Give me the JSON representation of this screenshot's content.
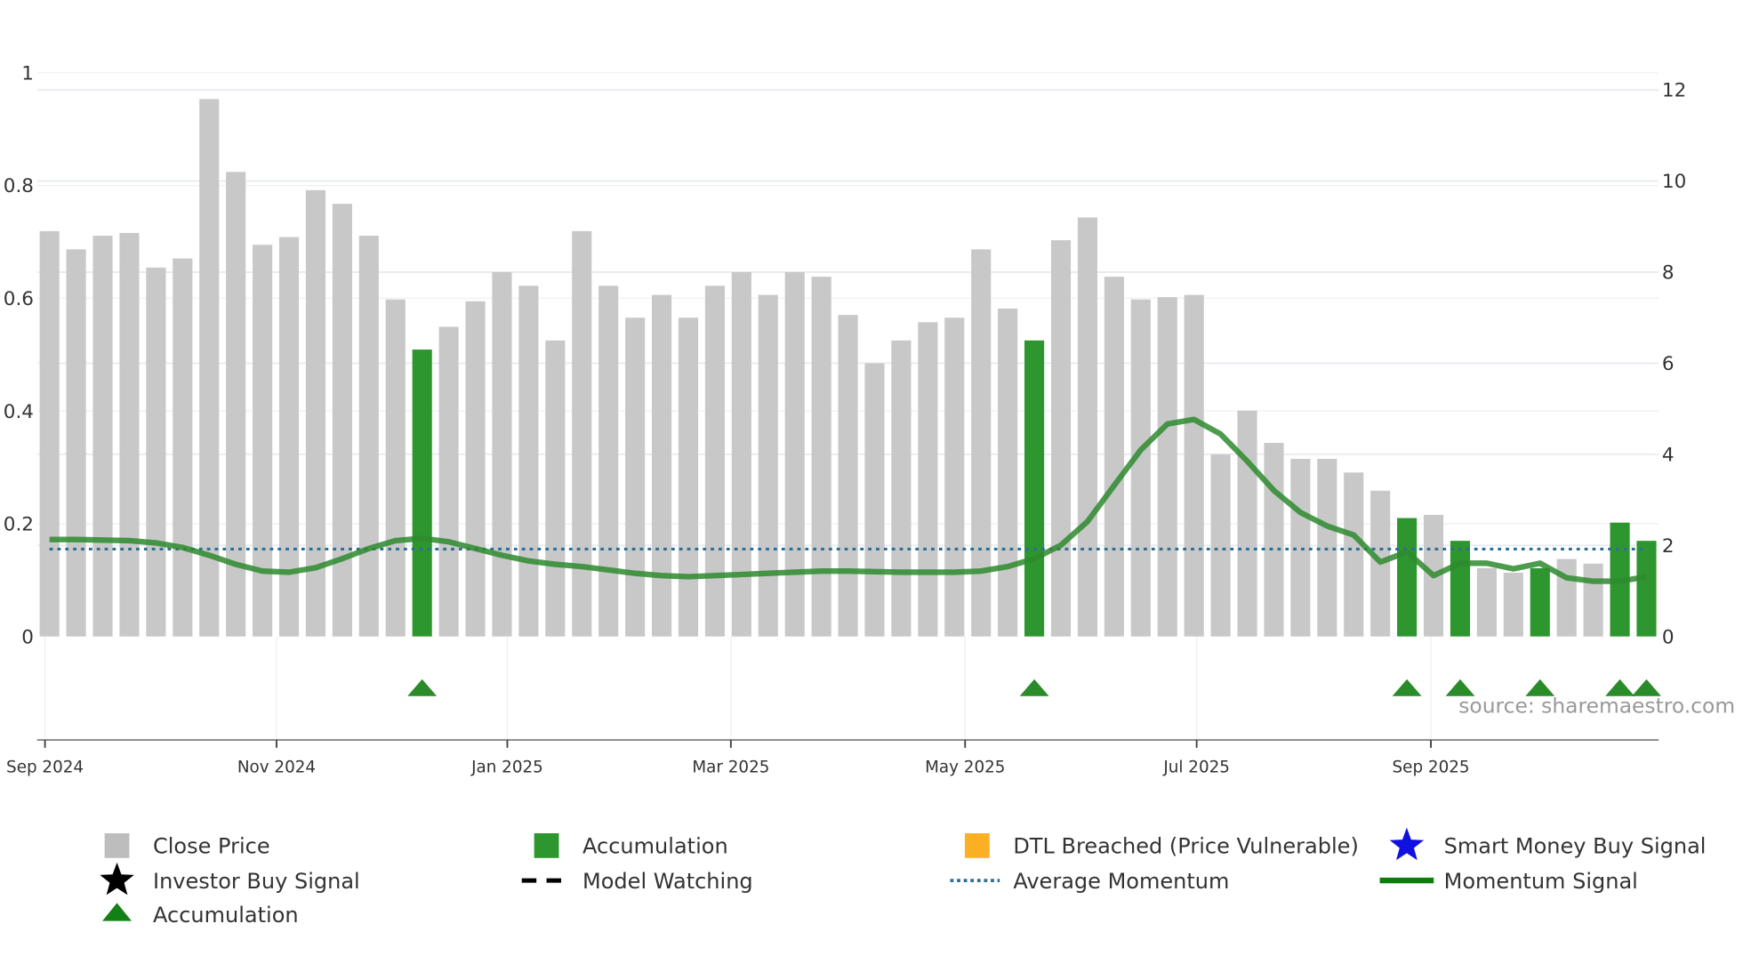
{
  "chart_data": {
    "type": "bar",
    "title": "",
    "colors": {
      "close": "#c8c8c8",
      "accumulation": "#2e962e",
      "momentum": "#1f8a1f",
      "average": "#2f6f96",
      "triangle": "#128012",
      "dtl": "#fbb024",
      "smart_money": "#1010e0",
      "investor": "#000000"
    },
    "left_axis": {
      "range": [
        0,
        1
      ],
      "ticks": [
        0,
        0.2,
        0.4,
        0.6,
        0.8,
        1
      ],
      "tick_labels": [
        "0",
        "0.2",
        "0.4",
        "0.6",
        "0.8",
        "1"
      ]
    },
    "right_axis": {
      "range": [
        0,
        12
      ],
      "ticks": [
        0,
        2,
        4,
        6,
        8,
        10,
        12
      ],
      "tick_labels": [
        "0",
        "2",
        "4",
        "6",
        "8",
        "10",
        "12"
      ]
    },
    "x_ticks": [
      {
        "label": "Sep 2024",
        "at": 0.83
      },
      {
        "label": "Nov 2024",
        "at": 9.53
      },
      {
        "label": "Jan 2025",
        "at": 18.2
      },
      {
        "label": "Mar 2025",
        "at": 26.6
      },
      {
        "label": "May 2025",
        "at": 35.4
      },
      {
        "label": "Jul 2025",
        "at": 44.1
      },
      {
        "label": "Sep 2025",
        "at": 52.9
      }
    ],
    "close_price": [
      8.9,
      8.5,
      8.8,
      8.86,
      8.1,
      8.3,
      11.8,
      10.2,
      8.6,
      8.77,
      9.8,
      9.5,
      8.8,
      7.4,
      6.3,
      6.8,
      7.36,
      8.0,
      7.7,
      6.5,
      8.9,
      7.7,
      7.0,
      7.5,
      7.0,
      7.7,
      8.0,
      7.5,
      8.0,
      7.9,
      7.06,
      6.0,
      6.5,
      6.9,
      7.0,
      8.5,
      7.2,
      6.5,
      8.7,
      9.2,
      7.9,
      7.4,
      7.45,
      7.5,
      4.0,
      4.96,
      4.25,
      3.9,
      3.9,
      3.6,
      3.2,
      2.6,
      2.67,
      2.1,
      1.5,
      1.4,
      1.5,
      1.7,
      1.6,
      2.5,
      2.1
    ],
    "accumulation_bars": [
      15,
      38,
      52,
      54,
      57,
      60,
      61
    ],
    "momentum_signal": [
      0.172,
      0.172,
      0.171,
      0.17,
      0.166,
      0.158,
      0.144,
      0.128,
      0.116,
      0.114,
      0.122,
      0.138,
      0.156,
      0.17,
      0.174,
      0.168,
      0.156,
      0.144,
      0.134,
      0.128,
      0.124,
      0.118,
      0.112,
      0.108,
      0.106,
      0.108,
      0.11,
      0.112,
      0.114,
      0.116,
      0.116,
      0.115,
      0.114,
      0.114,
      0.114,
      0.116,
      0.124,
      0.138,
      0.162,
      0.204,
      0.268,
      0.331,
      0.377,
      0.385,
      0.359,
      0.311,
      0.259,
      0.22,
      0.196,
      0.18,
      0.132,
      0.15,
      0.108,
      0.13,
      0.13,
      0.12,
      0.13,
      0.104,
      0.098,
      0.098,
      0.106
    ],
    "average_momentum": 0.155,
    "accumulation_triangles": [
      15,
      38,
      52,
      54,
      57,
      60,
      61
    ],
    "legend": [
      {
        "label": "Close Price",
        "icon": "gray-square"
      },
      {
        "label": "Accumulation",
        "icon": "green-square"
      },
      {
        "label": "DTL Breached (Price Vulnerable)",
        "icon": "orange-square"
      },
      {
        "label": "Smart Money Buy Signal",
        "icon": "blue-star"
      },
      {
        "label": "Investor Buy Signal",
        "icon": "black-star"
      },
      {
        "label": "Model Watching",
        "icon": "black-dash"
      },
      {
        "label": "Average Momentum",
        "icon": "blue-dotted-line"
      },
      {
        "label": "Momentum Signal",
        "icon": "green-line"
      },
      {
        "label": "Accumulation",
        "icon": "green-triangle"
      }
    ],
    "legend_position": "bottom",
    "source": "source: sharemaestro.com"
  }
}
